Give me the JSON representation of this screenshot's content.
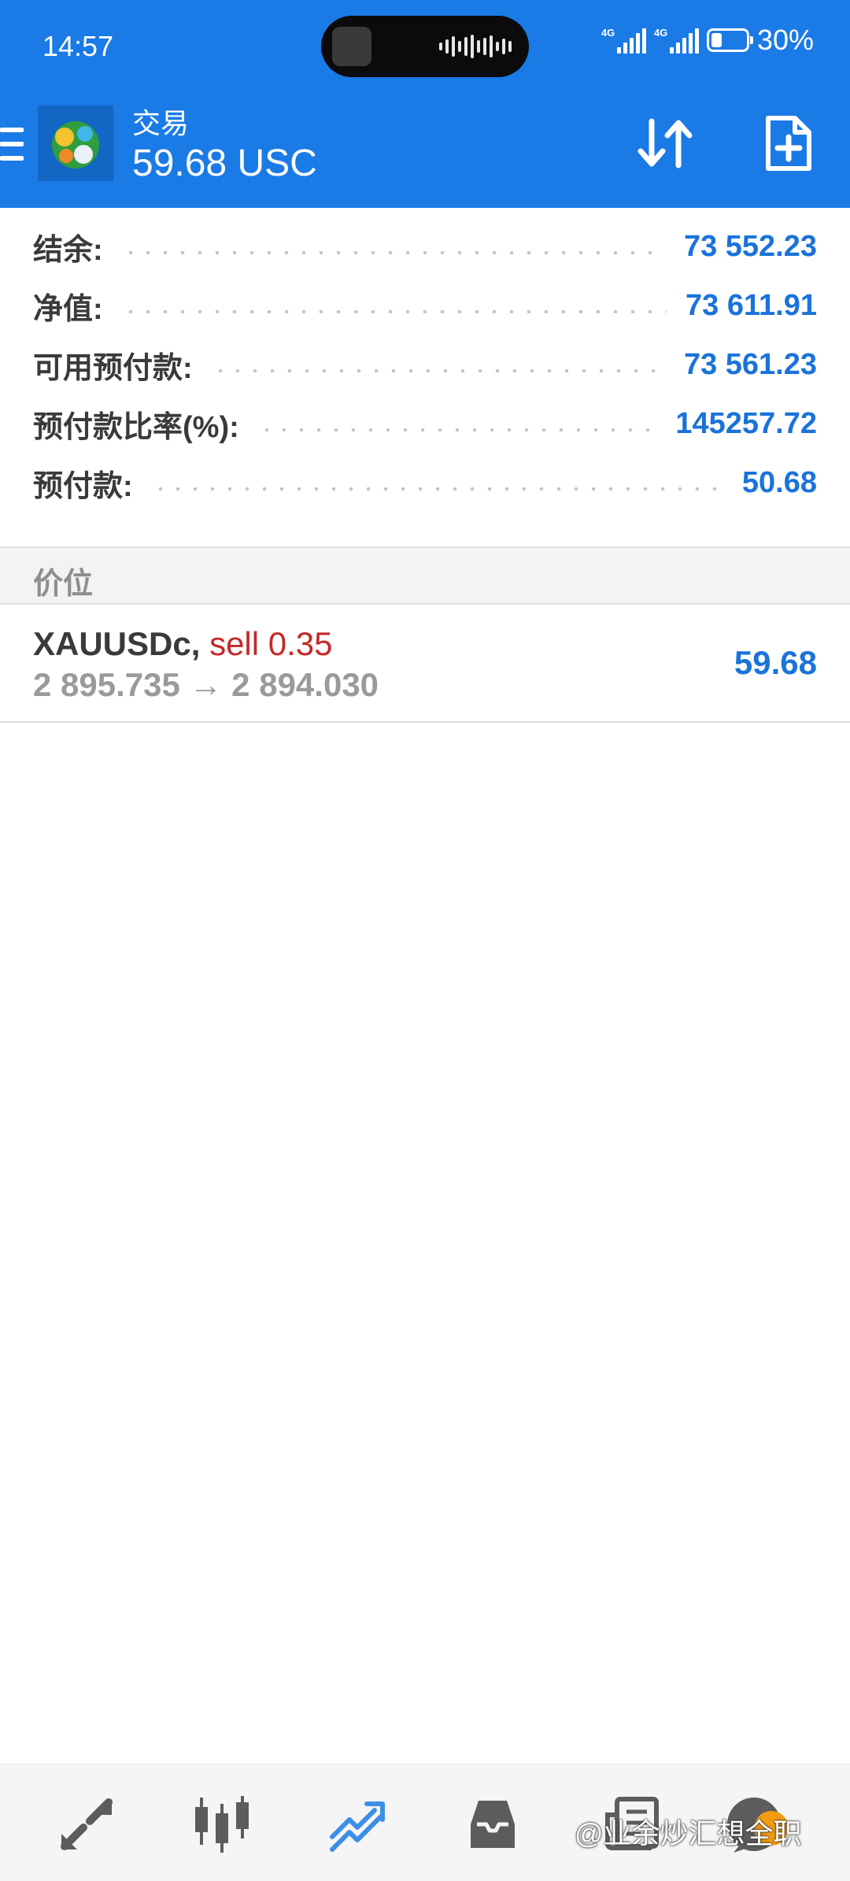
{
  "status_bar": {
    "time": "14:57",
    "network1": "4G",
    "network2": "4G",
    "battery_percent": "30%",
    "battery_level": 0.3
  },
  "header": {
    "title": "交易",
    "subtitle": "59.68 USC",
    "icons": {
      "menu": "menu-icon",
      "sort": "sort-arrows-icon",
      "new_order": "new-order-document-icon"
    }
  },
  "summary": {
    "rows": [
      {
        "label": "结余:",
        "value": "73 552.23"
      },
      {
        "label": "净值:",
        "value": "73 611.91"
      },
      {
        "label": "可用预付款:",
        "value": "73 561.23"
      },
      {
        "label": "预付款比率(%):",
        "value": "145257.72"
      },
      {
        "label": "预付款:",
        "value": "50.68"
      }
    ]
  },
  "positions": {
    "section_title": "价位",
    "items": [
      {
        "symbol": "XAUUSDc,",
        "side": "sell 0.35",
        "prices": "2 895.735 → 2 894.030",
        "profit": "59.68"
      }
    ]
  },
  "bottom_nav": {
    "items": [
      "quotes-icon",
      "chart-icon",
      "trade-icon",
      "history-icon",
      "news-icon",
      "messages-icon"
    ],
    "active": "trade-icon"
  },
  "watermark": {
    "text": "@业余炒汇想全职"
  },
  "colors": {
    "accent": "#1a7ae6",
    "value_blue": "#1a73d9",
    "sell_red": "#c62828"
  }
}
